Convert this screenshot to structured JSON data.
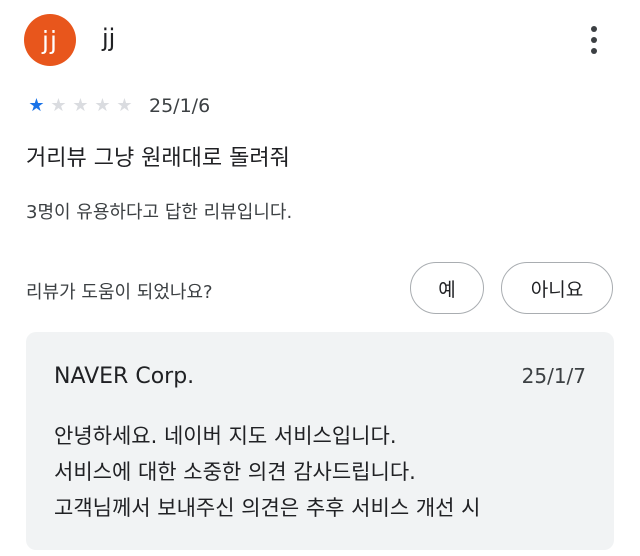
{
  "reviewer": {
    "avatar_initials": "jj",
    "avatar_color": "#e8561c",
    "name": "jj",
    "more_icon": "more-vert-icon"
  },
  "review": {
    "rating": 1,
    "max_rating": 5,
    "star_color": "#1a73e8",
    "date": "25/1/6",
    "text": "거리뷰 그냥 원래대로 돌려줘",
    "helpful_count_text": "3명이 유용하다고 답한 리뷰입니다."
  },
  "feedback": {
    "question": "리뷰가 도움이 되었나요?",
    "yes_label": "예",
    "no_label": "아니요"
  },
  "developer_reply": {
    "name": "NAVER Corp.",
    "date": "25/1/7",
    "lines": [
      "안녕하세요. 네이버 지도 서비스입니다.",
      "서비스에 대한 소중한 의견 감사드립니다.",
      "고객님께서 보내주신 의견은 추후 서비스 개선 시"
    ]
  }
}
